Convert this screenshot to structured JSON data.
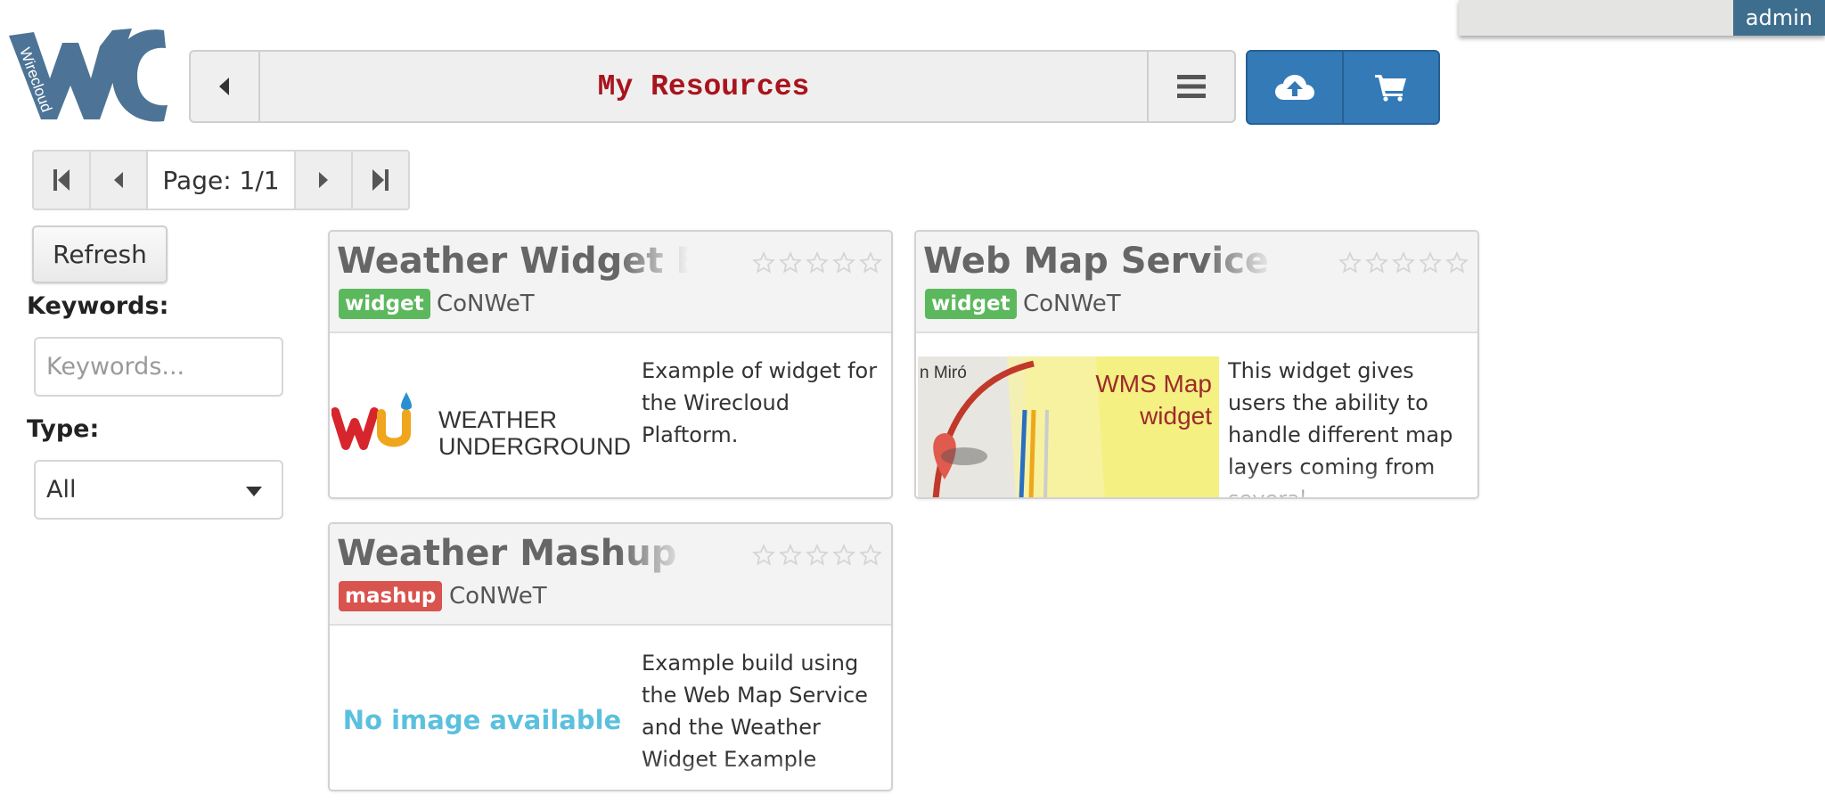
{
  "user": {
    "name": "admin"
  },
  "logo": {
    "text": "Wirecloud"
  },
  "header": {
    "title": "My Resources",
    "back_icon": "caret-left-icon",
    "menu_icon": "hamburger-menu-icon",
    "upload_icon": "cloud-upload-icon",
    "marketplace_icon": "shopping-cart-icon"
  },
  "pagination": {
    "label": "Page: 1/1"
  },
  "sidebar": {
    "refresh_label": "Refresh",
    "keywords_label": "Keywords:",
    "keywords_placeholder": "Keywords...",
    "type_label": "Type:",
    "type_selected": "All"
  },
  "resources": [
    {
      "title": "Weather Widget Example",
      "type": "widget",
      "vendor": "CoNWeT",
      "description": "Example of widget for the Wirecloud Plaftorm.",
      "image": {
        "logo_line1": "WEATHER",
        "logo_line2": "UNDERGROUND"
      },
      "rating": 0
    },
    {
      "title": "Web Map Service",
      "type": "widget",
      "vendor": "CoNWeT",
      "description": "This widget gives users the ability to handle different map layers coming from several",
      "image": {
        "caption_line1": "WMS Map",
        "caption_line2": "widget",
        "street_label": "n Miró"
      },
      "rating": 0
    },
    {
      "title": "Weather Mashup Example",
      "type": "mashup",
      "vendor": "CoNWeT",
      "description": "Example build using the Web Map Service and the Weather Widget Example",
      "image_placeholder": "No image available",
      "rating": 0
    }
  ],
  "colors": {
    "title_red": "#a8141d",
    "primary_blue": "#337ab7",
    "widget_green": "#5cb85c",
    "mashup_red": "#d9534f",
    "no_image_blue": "#5bc0de",
    "logo_blue": "#4d7496"
  }
}
